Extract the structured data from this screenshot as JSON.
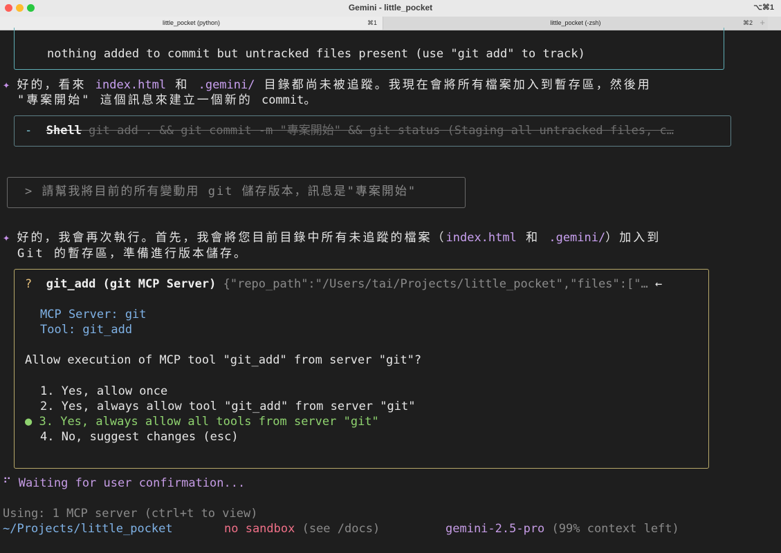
{
  "window": {
    "title": "Gemini - little_pocket",
    "shortcut": "⌥⌘1",
    "tabs": [
      {
        "label": "little_pocket (python)",
        "shortcut": "⌘1"
      },
      {
        "label": "little_pocket (-zsh)",
        "shortcut": "⌘2"
      }
    ],
    "new_tab_symbol": "+"
  },
  "terminal": {
    "git_status_line": "nothing added to commit but untracked files present (use \"git add\" to track)",
    "msg1": {
      "icon": "✦",
      "p1": "好的，看來 ",
      "code1": "index.html",
      "p2": " 和 ",
      "code2": ".gemini/",
      "p3": " 目錄都尚未被追蹤。我現在會將所有檔案加入到暫存區，然後用",
      "line2_a": "\"專案開始\" 這個訊息來建立一個新的 ",
      "line2_code": "commit",
      "line2_b": "。"
    },
    "shell_tool": {
      "marker": "-",
      "name": "Shell",
      "command": " git add . && git commit -m \"專案開始\" && git status (Staging all untracked files, c…"
    },
    "user_prompt": "> 請幫我將目前的所有變動用 git 儲存版本，訊息是\"專案開始\"",
    "msg2": {
      "icon": "✦",
      "p1": "好的，我會再次執行。首先，我會將您目前目錄中所有未追蹤的檔案（",
      "code1": "index.html",
      "p2": " 和 ",
      "code2": ".gemini/",
      "p3": "）加入到",
      "line2": "Git 的暫存區，準備進行版本儲存。"
    },
    "confirm": {
      "marker": "?",
      "tool_name": "git_add (git MCP Server)",
      "args": " {\"repo_path\":\"/Users/tai/Projects/little_pocket\",\"files\":[\"…",
      "arrow": "←",
      "server_line": "MCP Server: git",
      "tool_line": "Tool: git_add",
      "question": "Allow execution of MCP tool \"git_add\" from server \"git\"?",
      "options": [
        "1. Yes, allow once",
        "2. Yes, always allow tool \"git_add\" from server \"git\"",
        "3. Yes, always allow all tools from server \"git\"",
        "4. No, suggest changes (esc)"
      ],
      "selected_bullet": "●"
    },
    "waiting": {
      "spinner": "⠋",
      "text": "Waiting for user confirmation..."
    },
    "footer": {
      "using": "Using: 1 MCP server (ctrl+t to view)",
      "path": "~/Projects/little_pocket",
      "sandbox": "no sandbox",
      "sandbox_hint": " (see /docs)",
      "model": "gemini-2.5-pro",
      "context": " (99% context left)"
    }
  },
  "colors": {
    "background": "#1e1e1e",
    "accent_purple": "#c9a0f0",
    "selected_green": "#8fd36f",
    "sandbox_pink": "#f07088",
    "confirm_border": "#b8a96a"
  }
}
